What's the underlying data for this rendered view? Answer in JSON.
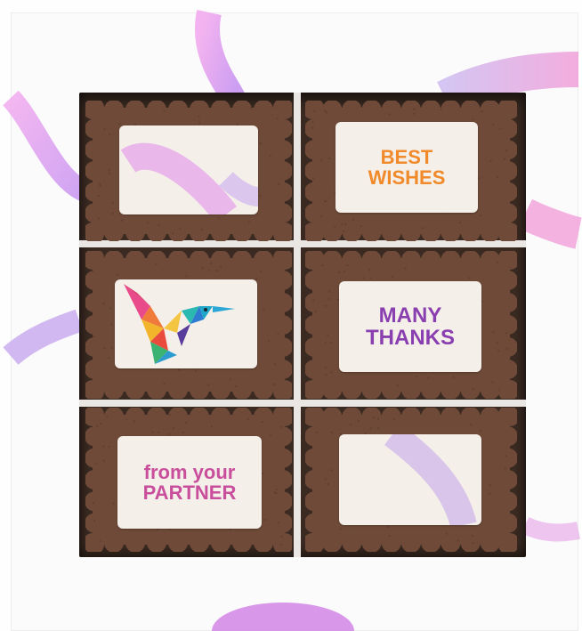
{
  "scene": {
    "colors": {
      "box": "#fbfbfb",
      "window_bg": "#3a2a22",
      "cookie": "#6f4a38",
      "label_paper": "#f4efe9",
      "ribbon_pink": "#e88ae0",
      "ribbon_purple": "#b79ae8"
    }
  },
  "cookies": [
    {
      "id": "top-left",
      "line1": "",
      "line2": ""
    },
    {
      "id": "top-right",
      "line1": "BEST",
      "line2": "WISHES",
      "text_color": "#f08a2a"
    },
    {
      "id": "middle-left",
      "icon": "hummingbird-icon"
    },
    {
      "id": "middle-right",
      "line1": "MANY",
      "line2": "THANKS",
      "text_color": "#8a3fb0"
    },
    {
      "id": "bottom-left",
      "line1": "from your",
      "line2": "PARTNER",
      "text_color": "#c94e9c"
    },
    {
      "id": "bottom-right",
      "line1": "",
      "line2": ""
    }
  ]
}
